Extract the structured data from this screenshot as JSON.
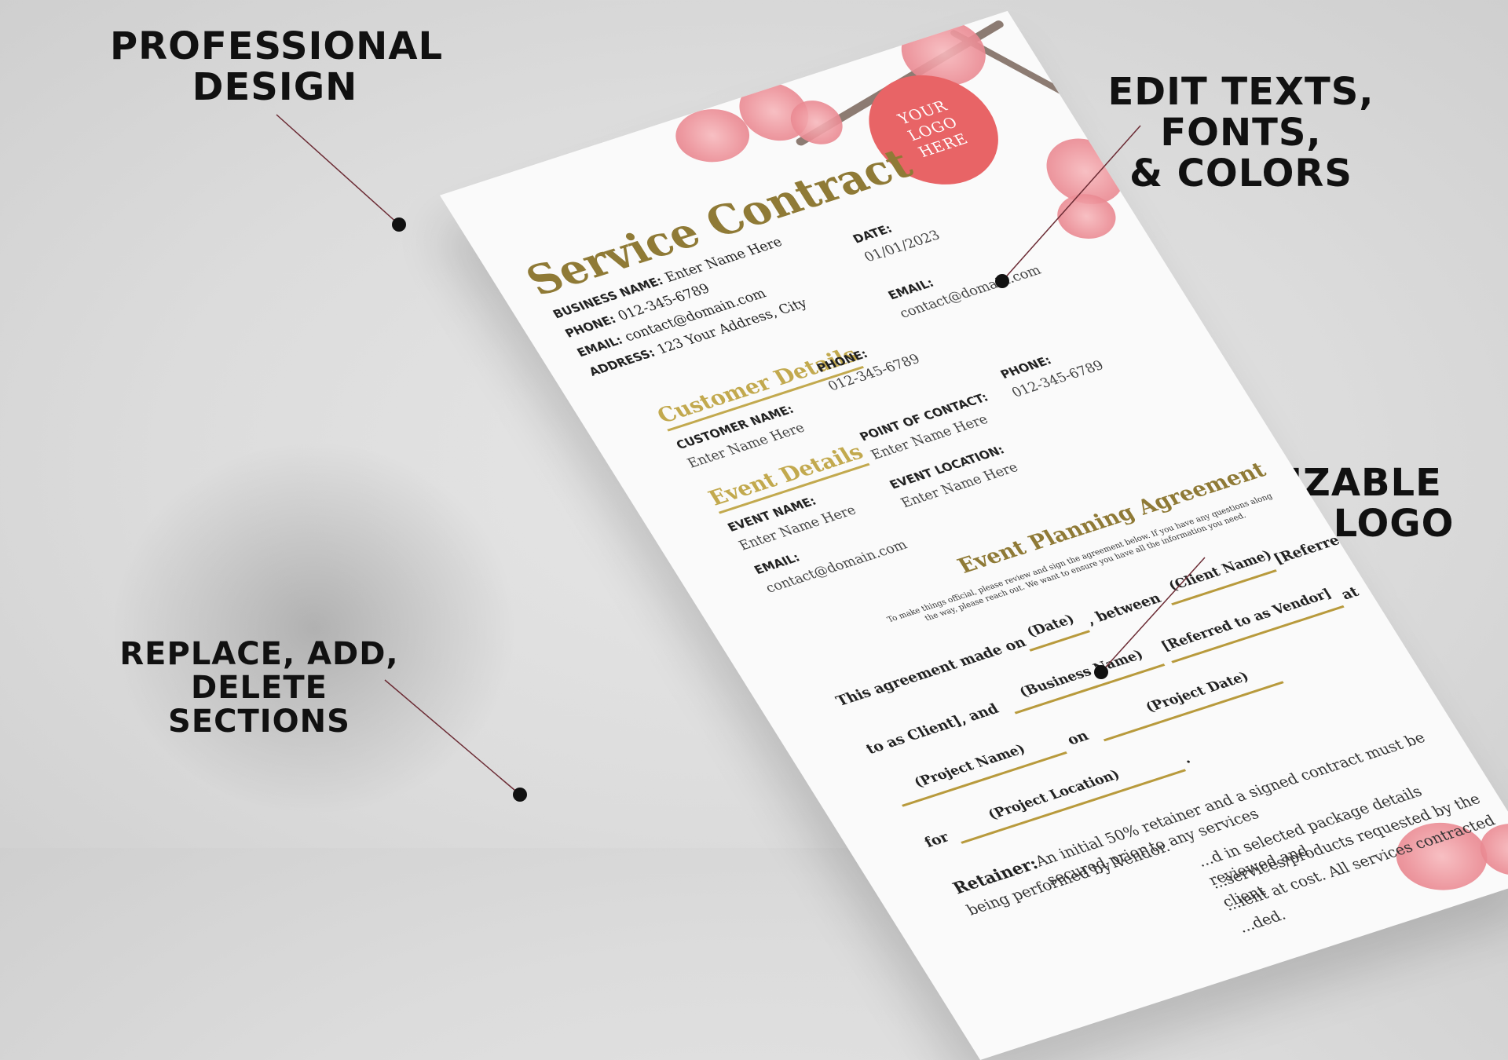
{
  "callouts": {
    "professional": [
      "PROFESSIONAL",
      "DESIGN"
    ],
    "edit": [
      "EDIT TEXTS, FONTS,",
      "& COLORS"
    ],
    "customizable": [
      "CUSTOMIZABLE",
      "ADD YOUR LOGO"
    ],
    "replace": [
      "REPLACE, ADD, DELETE",
      "SECTIONS"
    ]
  },
  "document": {
    "logo": [
      "YOUR",
      "LOGO",
      "HERE"
    ],
    "title": "Service Contract",
    "business": {
      "name_label": "BUSINESS NAME:",
      "name_value": "Enter Name Here",
      "phone_label": "PHONE:",
      "phone_value": "012-345-6789",
      "email_label": "EMAIL:",
      "email_value": "contact@domain.com",
      "address_label": "ADDRESS:",
      "address_value": "123 Your Address, City"
    },
    "date_label": "DATE:",
    "date_value": "01/01/2023",
    "top_email_label": "EMAIL:",
    "top_email_value": "contact@domain.com",
    "customer": {
      "heading": "Customer Details",
      "name_label": "CUSTOMER NAME:",
      "name_value": "Enter Name Here",
      "phone_label": "PHONE:",
      "phone_value": "012-345-6789"
    },
    "event": {
      "heading": "Event Details",
      "name_label": "EVENT NAME:",
      "name_value": "Enter Name Here",
      "contact_label": "POINT OF CONTACT:",
      "contact_value": "Enter Name Here",
      "phone_label": "PHONE:",
      "phone_value": "012-345-6789",
      "location_label": "EVENT LOCATION:",
      "location_value": "Enter Name Here",
      "email_label": "EMAIL:",
      "email_value": "contact@domain.com"
    },
    "agreement": {
      "title": "Event Planning Agreement",
      "intro": "To make things official, please review and sign the agreement below. If you have any questions along the way, please reach out. We want to ensure you have all the information you need.",
      "made_on": "This agreement made on",
      "date_ph": "(Date)",
      "between": ", between",
      "client_ph": "(Client Name)",
      "referred_client": "[Referred to as Client], and",
      "referred_open": "[Referred",
      "to_as_client": "to as Client], and",
      "business_ph": "(Business Name)",
      "referred_vendor": "[Referred to as Vendor]",
      "at": "at",
      "project_date_ph": "(Project Date)",
      "project_name_ph": "(Project Name)",
      "on": "on",
      "for": "for",
      "project_location_ph": "(Project Location)",
      "period": "."
    },
    "retainer": {
      "heading": "Retainer:",
      "line1": "An initial 50% retainer and a signed contract must be secured prior to any services",
      "line2": "being performed by Vendor.",
      "line3": "...d in selected package details reviewed and",
      "line4": "...services/products requested by the client",
      "line5": "...ient at cost. All services contracted",
      "line6": "...ded."
    }
  }
}
